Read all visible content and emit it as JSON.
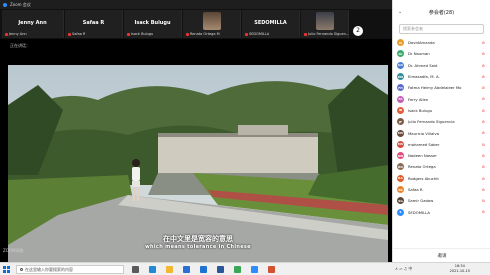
{
  "window": {
    "title": "Zoom 会议"
  },
  "gallery": {
    "tiles": [
      {
        "name_big": "Jenny Ann",
        "name_small": "Jenny Ann",
        "has_photo": false
      },
      {
        "name_big": "Safaa R",
        "name_small": "Safaa R",
        "has_photo": false
      },
      {
        "name_big": "Isack Bulugu",
        "name_small": "Isack Bulugu",
        "has_photo": false
      },
      {
        "name_big": "",
        "name_small": "Renato Ortega M",
        "has_photo": true
      },
      {
        "name_big": "SEDOMILLA",
        "name_small": "SEDOMILLA",
        "has_photo": false
      },
      {
        "name_big": "",
        "name_small": "Julio Fernando Siguen...",
        "has_photo": true
      }
    ],
    "next_label": "2"
  },
  "stage": {
    "speaker_label": "正在讲话：",
    "caption_cn": "在中文里是宽容的意思",
    "caption_en": "which means tolerance in Chinese",
    "bottom_label": "ZOOM网络"
  },
  "panel": {
    "header": "参会者(28)",
    "search_placeholder": "搜索参会者",
    "participants": [
      {
        "initials": "D",
        "name": "DavidAmanda",
        "color": "#e89b2f"
      },
      {
        "initials": "Dr",
        "name": "Dr Nauman",
        "color": "#3aa86b"
      },
      {
        "initials": "DA",
        "name": "Dr. Ahmed Said",
        "color": "#4a7fd1"
      },
      {
        "initials": "EM",
        "name": "Elmasadfa, M. A.",
        "color": "#2f8f9d"
      },
      {
        "initials": "FH",
        "name": "Fatma Helmy Abdelaleer Mo",
        "color": "#5b6ad0"
      },
      {
        "initials": "FA",
        "name": "Ferry Allen",
        "color": "#c45fb6"
      },
      {
        "initials": "IB",
        "name": "Isack Bulugu",
        "color": "#e35d3a"
      },
      {
        "initials": "JF",
        "name": "Julio Fernando Siguencia",
        "color": "#7c5a44"
      },
      {
        "initials": "MV",
        "name": "Mauricio Villalva",
        "color": "#6b4a3a"
      },
      {
        "initials": "MS",
        "name": "mohamed Saber",
        "color": "#d44a3c"
      },
      {
        "initials": "NN",
        "name": "Nadeen Nasser",
        "color": "#e04b7a"
      },
      {
        "initials": "RO",
        "name": "Renato Ortega",
        "color": "#8a6b55"
      },
      {
        "initials": "RA",
        "name": "Rodgers Akuchit",
        "color": "#e05a2a"
      },
      {
        "initials": "SR",
        "name": "Safaa R.",
        "color": "#e8832c"
      },
      {
        "initials": "SG",
        "name": "Samir Gadow",
        "color": "#5a4a3e"
      },
      {
        "initials": "S",
        "name": "SEDOMILLA",
        "color": "#2d8cff"
      }
    ],
    "footer_button": "邀请"
  },
  "taskbar": {
    "search_placeholder": "在这里输入你要搜索的内容",
    "time": "16:34",
    "date": "2021-10-15",
    "apps": [
      {
        "icon": "task-view-icon",
        "color": "#5a5a5a"
      },
      {
        "icon": "edge-icon",
        "color": "#1f8ad6"
      },
      {
        "icon": "explorer-icon",
        "color": "#f2b830"
      },
      {
        "icon": "store-icon",
        "color": "#2b6fd6"
      },
      {
        "icon": "mail-icon",
        "color": "#1e73d4"
      },
      {
        "icon": "word-icon",
        "color": "#2b579a"
      },
      {
        "icon": "chrome-icon",
        "color": "#3aa757"
      },
      {
        "icon": "zoom-icon",
        "color": "#2d8cff"
      },
      {
        "icon": "app-icon",
        "color": "#d35230"
      }
    ]
  }
}
